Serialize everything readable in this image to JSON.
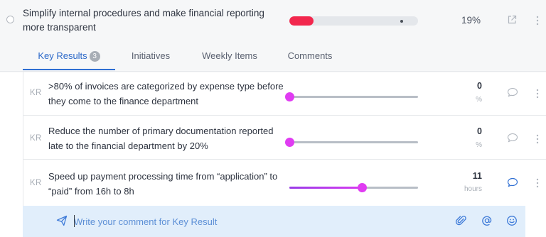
{
  "objective": {
    "title": "Simplify internal procedures and make financial reporting more transparent",
    "progress_percent": 19,
    "progress_label": "19%",
    "progress_color": "#f2274d"
  },
  "tabs": [
    {
      "label": "Key Results",
      "badge": "3",
      "active": true
    },
    {
      "label": "Initiatives",
      "active": false
    },
    {
      "label": "Weekly Items",
      "active": false
    },
    {
      "label": "Comments",
      "active": false
    }
  ],
  "key_results": [
    {
      "tag": "KR",
      "title": ">80% of invoices are categorized by expense type before they come to the finance department",
      "value": "0",
      "unit": "%",
      "slider_fraction": 0,
      "comment_active": false
    },
    {
      "tag": "KR",
      "title": "Reduce the number of primary documentation reported late to the financial department by 20%",
      "value": "0",
      "unit": "%",
      "slider_fraction": 0,
      "comment_active": false
    },
    {
      "tag": "KR",
      "title": "Speed up payment processing time from “application” to “paid” from 16h to 8h",
      "value": "11",
      "unit": "hours",
      "slider_fraction": 0.5625,
      "comment_active": true
    }
  ],
  "comment_box": {
    "placeholder": "Write your comment for Key Result",
    "icons": [
      "send-icon",
      "attachment-icon",
      "mention-icon",
      "emoji-icon"
    ]
  },
  "colors": {
    "accent": "#2f6fd3",
    "slider": "#e03cf2",
    "objective_bar": "#f2274d"
  }
}
